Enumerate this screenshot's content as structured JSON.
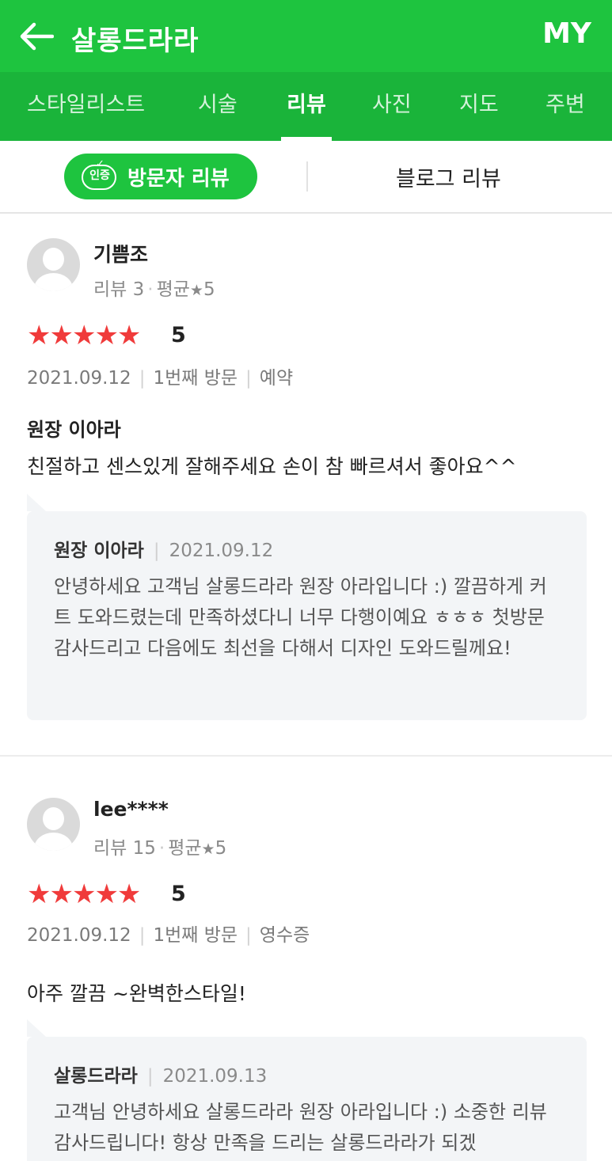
{
  "header": {
    "title": "살롱드라라",
    "my_label": "MY",
    "back_icon": "arrow-left-icon"
  },
  "tabs": [
    {
      "label": "스타일리스트",
      "active": false
    },
    {
      "label": "시술",
      "active": false
    },
    {
      "label": "리뷰",
      "active": true
    },
    {
      "label": "사진",
      "active": false
    },
    {
      "label": "지도",
      "active": false
    },
    {
      "label": "주변",
      "active": false
    }
  ],
  "segment": {
    "badge": "인증",
    "visitor_label": "방문자 리뷰",
    "blog_label": "블로그 리뷰"
  },
  "reviews": [
    {
      "username": "기쁨조",
      "review_count": "리뷰 3",
      "avg_label": "평균",
      "avg_score": "5",
      "stars": "★★★★★",
      "score": "5",
      "date": "2021.09.12",
      "visit": "1번째 방문",
      "method": "예약",
      "stylist": "원장 이아라",
      "content": "친절하고 센스있게 잘해주세요 손이 참 빠르셔서 좋아요^^",
      "reply": {
        "name": "원장 이아라",
        "date": "2021.09.12",
        "text": "안녕하세요 고객님 살롱드라라 원장 아라입니다 :) 깔끔하게 커트 도와드렸는데 만족하셨다니 너무 다행이예요 ㅎㅎㅎ 첫방문 감사드리고 다음에도 최선을 다해서 디자인 도와드릴께요!"
      }
    },
    {
      "username": "lee****",
      "review_count": "리뷰 15",
      "avg_label": "평균",
      "avg_score": "5",
      "stars": "★★★★★",
      "score": "5",
      "date": "2021.09.12",
      "visit": "1번째 방문",
      "method": "영수증",
      "content": "아주 깔끔 ~완벽한스타일!",
      "reply": {
        "name": "살롱드라라",
        "date": "2021.09.13",
        "text": "고객님 안녕하세요 살롱드라라 원장 아라입니다 :) 소중한 리뷰 감사드립니다! 항상 만족을 드리는 살롱드라라가 되겠"
      }
    }
  ],
  "colors": {
    "brand_green": "#1ec43f",
    "tab_green": "#1ab43a",
    "star_red": "#f03b3b"
  }
}
